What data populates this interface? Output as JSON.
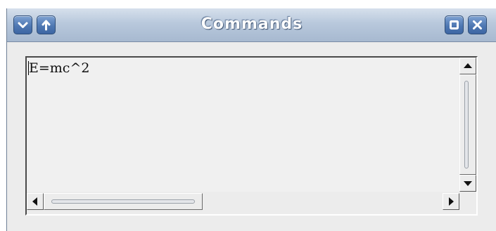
{
  "window": {
    "title": "Commands",
    "titlebar_buttons": {
      "minimize_icon": "chevron-down-icon",
      "raise_icon": "arrow-up-icon",
      "maximize_icon": "square-icon",
      "close_icon": "close-icon"
    },
    "colors": {
      "titlebar": "#b8c8dc",
      "button": "#4f78b3",
      "background": "#ececec",
      "text_area": "#f0f0f0"
    }
  },
  "editor": {
    "text": "E=mc^2"
  },
  "scrollbars": {
    "up_icon": "triangle-up-icon",
    "down_icon": "triangle-down-icon",
    "left_icon": "triangle-left-icon",
    "right_icon": "triangle-right-icon"
  }
}
